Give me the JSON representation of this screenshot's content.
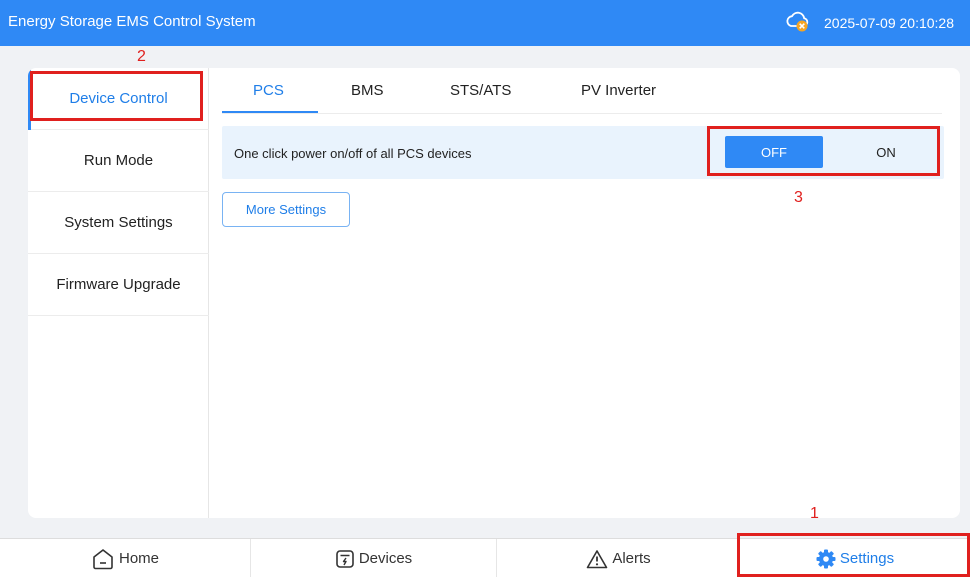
{
  "header": {
    "title": "Energy Storage EMS Control System",
    "datetime": "2025-07-09 20:10:28",
    "status_icon": "cloud-offline-icon",
    "colors": {
      "header_bg": "#2f89f5",
      "accent": "#1f7ee8",
      "warning": "#f5a524",
      "annotation": "#e0201e"
    }
  },
  "sidebar": {
    "items": [
      {
        "label": "Device Control",
        "active": true
      },
      {
        "label": "Run Mode"
      },
      {
        "label": "System Settings"
      },
      {
        "label": "Firmware Upgrade"
      }
    ]
  },
  "tabs": [
    {
      "label": "PCS",
      "active": true
    },
    {
      "label": "BMS"
    },
    {
      "label": "STS/ATS"
    },
    {
      "label": "PV Inverter"
    }
  ],
  "power": {
    "label": "One click power on/off of all PCS devices",
    "off_label": "OFF",
    "on_label": "ON",
    "selected": "OFF"
  },
  "more_settings_label": "More Settings",
  "bottom_nav": [
    {
      "label": "Home",
      "icon": "home-icon"
    },
    {
      "label": "Devices",
      "icon": "devices-icon"
    },
    {
      "label": "Alerts",
      "icon": "alert-icon"
    },
    {
      "label": "Settings",
      "icon": "gear-icon",
      "active": true
    }
  ],
  "annotations": [
    "1",
    "2",
    "3"
  ]
}
